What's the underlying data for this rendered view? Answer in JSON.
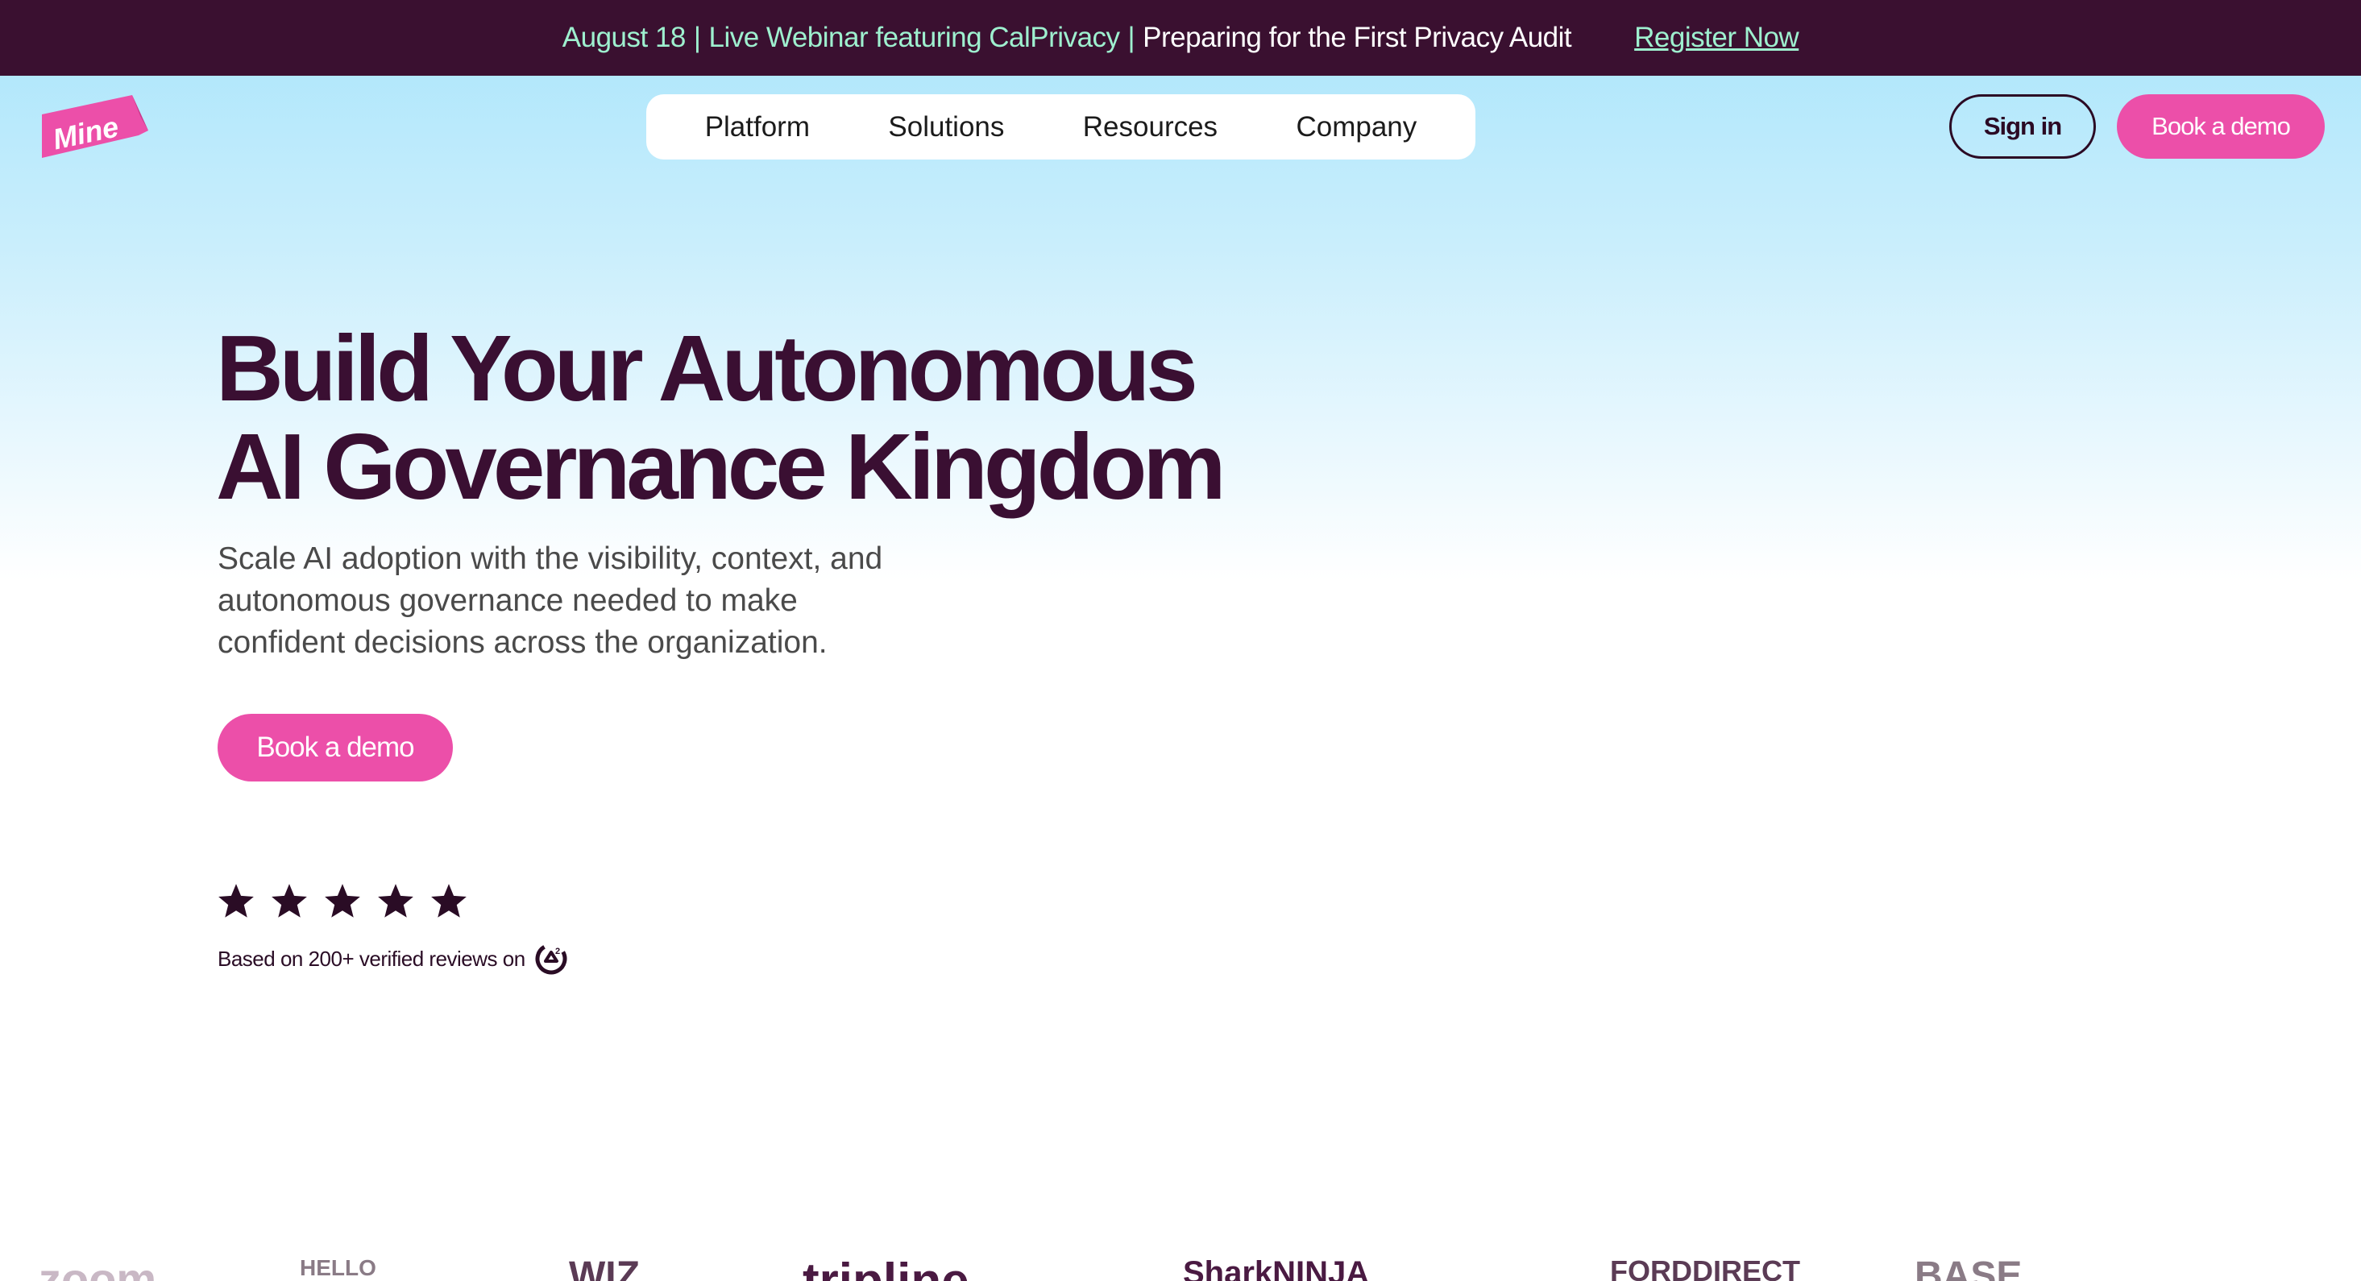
{
  "announcement": {
    "date": "August 18",
    "event": "Live Webinar featuring CalPrivacy",
    "separator": "|",
    "message": "Preparing for the First Privacy Audit",
    "register_label": "Register Now"
  },
  "logo": {
    "text": "Mine"
  },
  "nav": {
    "items": [
      {
        "label": "Platform"
      },
      {
        "label": "Solutions"
      },
      {
        "label": "Resources"
      },
      {
        "label": "Company"
      }
    ]
  },
  "header_actions": {
    "sign_in_label": "Sign in",
    "book_demo_label": "Book a demo"
  },
  "hero": {
    "title_line1": "Build Your Autonomous",
    "title_line2": "AI Governance Kingdom",
    "subtitle_line1": "Scale AI adoption with the visibility, context, and",
    "subtitle_line2": "autonomous governance needed to make",
    "subtitle_line3": "confident decisions across the organization.",
    "cta_label": "Book a demo"
  },
  "rating": {
    "stars": 5,
    "reviews_text": "Based on 200+ verified reviews on",
    "platform_icon": "g2-icon"
  },
  "customer_logos": [
    {
      "label": "zoom"
    },
    {
      "label": "HELLO"
    },
    {
      "label": "WIZ"
    },
    {
      "label": "tripline"
    },
    {
      "label": "SharkNINJA"
    },
    {
      "label": "FORDDIRECT"
    },
    {
      "label": "BASE"
    }
  ],
  "colors": {
    "banner_bg": "#3a1030",
    "banner_accent": "#9ef0cf",
    "brand_pink": "#ec4fa9",
    "heading": "#3a0f32"
  }
}
